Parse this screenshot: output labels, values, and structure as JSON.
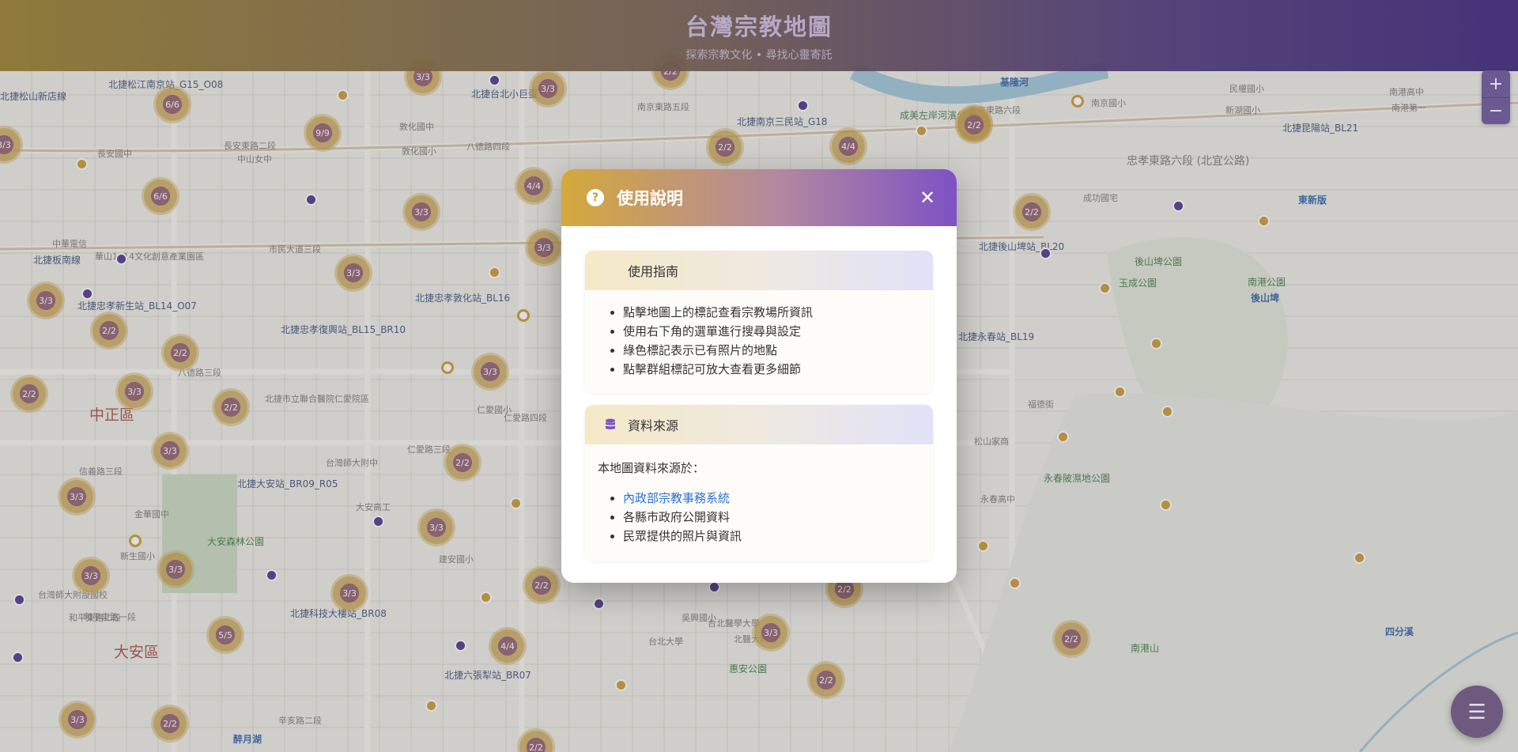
{
  "app": {
    "title": "台灣宗教地圖",
    "subtitle": "探索宗教文化 • 尋找心靈寄託"
  },
  "zoom": {
    "in_label": "+",
    "out_label": "−"
  },
  "fab": {
    "icon": "menu-icon",
    "label": "☰"
  },
  "modal": {
    "icon_label": "?",
    "title": "使用說明",
    "close_label": "✕",
    "guide": {
      "title": "使用指南",
      "items": [
        "點擊地圖上的標記查看宗教場所資訊",
        "使用右下角的選單進行搜尋與設定",
        "綠色標記表示已有照片的地點",
        "點擊群組標記可放大查看更多細節"
      ]
    },
    "sources": {
      "title": "資料來源",
      "icon": "database-icon",
      "intro": "本地圖資料來源於：",
      "link_label": "內政部宗教事務系統",
      "items": [
        "各縣市政府公開資料",
        "民眾提供的照片與資訊"
      ]
    }
  },
  "colors": {
    "header_start": "#8a7430",
    "header_end": "#3b2772",
    "accent_gold": "#c9962f",
    "accent_purple": "#4a2f8a",
    "link": "#2b6fd6"
  },
  "map": {
    "labels": [
      {
        "text": "北捷松山新店線",
        "cls": "metro"
      },
      {
        "text": "北捷松江南京站_G15_O08",
        "cls": "metro"
      },
      {
        "text": "北捷台北小巨蛋",
        "cls": "metro"
      },
      {
        "text": "南京東路五段",
        "cls": "road"
      },
      {
        "text": "北捷南京三民站_G18",
        "cls": "metro"
      },
      {
        "text": "南京東路六段",
        "cls": "road"
      },
      {
        "text": "南京國小",
        "cls": "road"
      },
      {
        "text": "新湖國小",
        "cls": "road"
      },
      {
        "text": "南港高中",
        "cls": "road"
      },
      {
        "text": "民權國小",
        "cls": "road"
      },
      {
        "text": "成功國宅",
        "cls": "road"
      },
      {
        "text": "北捷昆陽站_BL21",
        "cls": "metro"
      },
      {
        "text": "南港第一",
        "cls": "road"
      },
      {
        "text": "忠孝東路六段 (北宜公路)",
        "cls": "road"
      },
      {
        "text": "東新版",
        "cls": "blue"
      },
      {
        "text": "後山埤",
        "cls": "blue"
      },
      {
        "text": "南港公園",
        "cls": "park"
      },
      {
        "text": "後山埤公園",
        "cls": "park"
      },
      {
        "text": "玉成公園",
        "cls": "park"
      },
      {
        "text": "中正區",
        "cls": "district"
      },
      {
        "text": "大安區",
        "cls": "district"
      },
      {
        "text": "北捷板南線",
        "cls": "metro"
      },
      {
        "text": "北捷忠孝新生站_BL14_O07",
        "cls": "metro"
      },
      {
        "text": "北捷忠孝復興站_BL15_BR10",
        "cls": "metro"
      },
      {
        "text": "北捷忠孝敦化站_BL16",
        "cls": "metro"
      },
      {
        "text": "北捷市立聯合醫院仁愛院區",
        "cls": "road"
      },
      {
        "text": "北捷大安站_BR09_R05",
        "cls": "metro"
      },
      {
        "text": "北捷科技大樓站_BR08",
        "cls": "metro"
      },
      {
        "text": "北捷六張犁站_BR07",
        "cls": "metro"
      },
      {
        "text": "大安森林公園",
        "cls": "park"
      },
      {
        "text": "市民大道三段",
        "cls": "road"
      },
      {
        "text": "八德路四段",
        "cls": "road"
      },
      {
        "text": "八德路三段",
        "cls": "road"
      },
      {
        "text": "仁愛路四段",
        "cls": "road"
      },
      {
        "text": "仁愛路三段",
        "cls": "road"
      },
      {
        "text": "信義路三段",
        "cls": "road"
      },
      {
        "text": "和平東路二段",
        "cls": "road"
      },
      {
        "text": "辛亥路二段",
        "cls": "road"
      },
      {
        "text": "長安東路二段",
        "cls": "road"
      },
      {
        "text": "敦化國中",
        "cls": "road"
      },
      {
        "text": "敦化國小",
        "cls": "road"
      },
      {
        "text": "中山女中",
        "cls": "road"
      },
      {
        "text": "長安國中",
        "cls": "road"
      },
      {
        "text": "中華電信",
        "cls": "road"
      },
      {
        "text": "華山1914文化創意產業園區",
        "cls": "road"
      },
      {
        "text": "台灣師大附中",
        "cls": "road"
      },
      {
        "text": "仁愛國小",
        "cls": "road"
      },
      {
        "text": "大安高工",
        "cls": "road"
      },
      {
        "text": "建安國小",
        "cls": "road"
      },
      {
        "text": "金華國中",
        "cls": "road"
      },
      {
        "text": "新生國小",
        "cls": "road"
      },
      {
        "text": "台灣師大附設國校",
        "cls": "road"
      },
      {
        "text": "和平東路一段",
        "cls": "road"
      },
      {
        "text": "北醫大附醫",
        "cls": "road"
      },
      {
        "text": "台北醫學大學",
        "cls": "road"
      },
      {
        "text": "惠安公園",
        "cls": "park"
      },
      {
        "text": "吳興國小",
        "cls": "road"
      },
      {
        "text": "台北大學",
        "cls": "road"
      },
      {
        "text": "醉月湖",
        "cls": "blue"
      },
      {
        "text": "南港山",
        "cls": "park"
      },
      {
        "text": "永春高中",
        "cls": "road"
      },
      {
        "text": "永春陂濕地公園",
        "cls": "park"
      },
      {
        "text": "松山家商",
        "cls": "road"
      },
      {
        "text": "福德街",
        "cls": "road"
      },
      {
        "text": "四分溪",
        "cls": "blue"
      },
      {
        "text": "北捷永春站_BL19",
        "cls": "metro"
      },
      {
        "text": "北捷後山埤站_BL20",
        "cls": "metro"
      },
      {
        "text": "基隆河",
        "cls": "blue"
      },
      {
        "text": "成美左岸河濱公園",
        "cls": "park"
      }
    ],
    "clusters": [
      "3/3",
      "6/6",
      "9/9",
      "6/6",
      "2/2",
      "2/2",
      "4/4",
      "3/3",
      "2/2",
      "3/3",
      "3/3",
      "4/4",
      "3/3",
      "2/2",
      "2/2",
      "2/2",
      "3/3",
      "3/3",
      "2/2",
      "2/2",
      "3/3",
      "2/2",
      "3/3",
      "3/3",
      "3/3",
      "3/3",
      "2/2",
      "3/3",
      "5/5",
      "4/4",
      "3/3",
      "3/3",
      "2/2",
      "2/2",
      "3/3",
      "2/2",
      "2/2",
      "2/2",
      "3/3",
      "2/2"
    ]
  }
}
